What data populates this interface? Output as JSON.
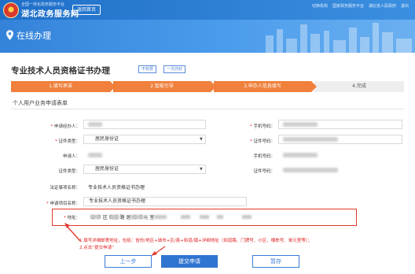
{
  "header": {
    "site_subtitle": "全国一体化政务服务平台",
    "site_name": "湖北政务服务网",
    "back_home": "返回首页",
    "links": [
      "切换机构",
      "国家政务服务平台",
      "湖北省人民政府",
      "退出"
    ]
  },
  "banner": {
    "title": "在线办理"
  },
  "page": {
    "title": "专业技术人员资格证书办理",
    "tags": [
      "不收费",
      "一次办好"
    ]
  },
  "steps": [
    {
      "label": "1.填写承诺"
    },
    {
      "label": "2.智能引导"
    },
    {
      "label": "3.申办人信息填写"
    },
    {
      "label": "4.完成"
    }
  ],
  "form": {
    "section_title": "个人用户业务申请表单",
    "rows": {
      "applicant_agent_label": "申请经办人：",
      "phone_label": "手机号码：",
      "id_type_label": "证件类型：",
      "id_type_value": "居民身份证",
      "id_number_label": "证件号码：",
      "applicant_label": "申请人：",
      "phone2_label": "手机号码：",
      "id_type2_label": "证件类型：",
      "id_type2_value": "居民身份证",
      "id_number2_label": "证件号码：",
      "legal_item_label": "法定事项名称：",
      "legal_item_value": "专业技术人员资格证书办理",
      "apply_item_label": "申请项目名称：",
      "apply_item_value": "专业技术人员资格证书办理",
      "address_label": "地址：",
      "address_value": "省   市   区     街道     路   居   栋   单元     室"
    }
  },
  "note": {
    "line1": "1.填写详细邮寄地址，包括：省份/地区+城市+区/县+街道/镇+详细地址（如道路、门牌号、小区、楼栋号、单元室等）；",
    "line2": "2.点击“提交申请”"
  },
  "buttons": {
    "prev": "上一步",
    "submit": "提交申请",
    "save": "暂存"
  },
  "colors": {
    "header_blue": "#1f6fc8",
    "step_orange": "#f0803c",
    "highlight_red": "#e23a2e",
    "primary_button": "#2f74d0"
  }
}
